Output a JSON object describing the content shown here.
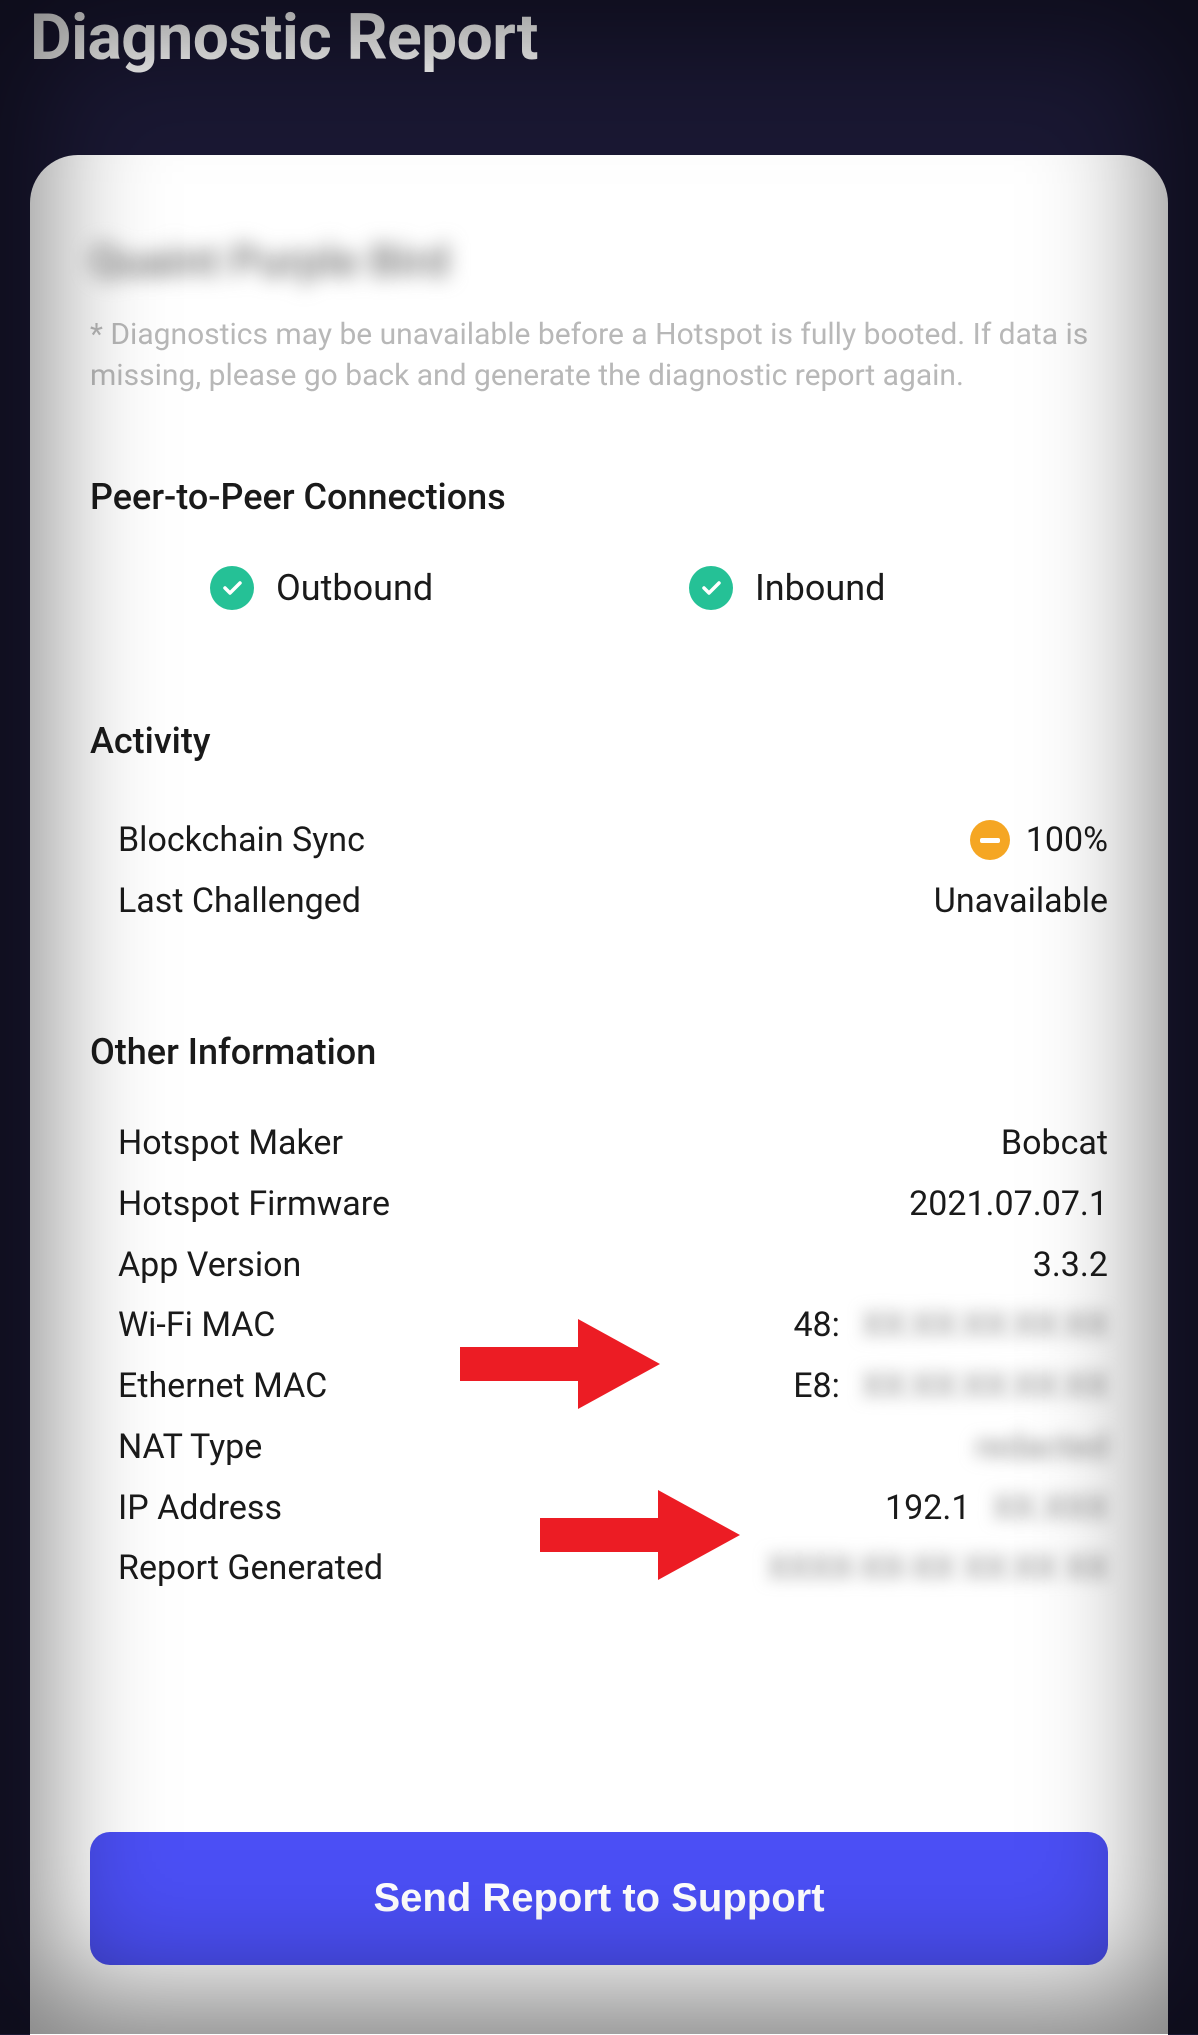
{
  "header": {
    "title": "Diagnostic Report"
  },
  "hotspot_name": "Quaint Purple Bird",
  "disclaimer": "* Diagnostics may be unavailable before a Hotspot is fully booted. If data is missing, please go back and generate the diagnostic report again.",
  "p2p": {
    "title": "Peer-to-Peer Connections",
    "outbound_label": "Outbound",
    "outbound_ok": true,
    "inbound_label": "Inbound",
    "inbound_ok": true
  },
  "activity": {
    "title": "Activity",
    "blockchain_sync_label": "Blockchain Sync",
    "blockchain_sync_value": "100%",
    "blockchain_sync_status": "warning",
    "last_challenged_label": "Last Challenged",
    "last_challenged_value": "Unavailable"
  },
  "other": {
    "title": "Other Information",
    "rows": {
      "hotspot_maker": {
        "label": "Hotspot Maker",
        "value": "Bobcat"
      },
      "hotspot_firmware": {
        "label": "Hotspot Firmware",
        "value": "2021.07.07.1"
      },
      "app_version": {
        "label": "App Version",
        "value": "3.3.2"
      },
      "wifi_mac": {
        "label": "Wi-Fi MAC",
        "prefix": "48:",
        "redacted": "XX:XX:XX:XX:XX"
      },
      "ethernet_mac": {
        "label": "Ethernet MAC",
        "prefix": "E8:",
        "redacted": "XX:XX:XX:XX:XX"
      },
      "nat_type": {
        "label": "NAT Type",
        "redacted": "redacted"
      },
      "ip_address": {
        "label": "IP Address",
        "prefix": "192.1",
        "redacted": "XX.XXX"
      },
      "report_generated": {
        "label": "Report Generated",
        "redacted": "XXXX-XX-XX XX:XX XX"
      }
    }
  },
  "send_button_label": "Send Report to Support",
  "colors": {
    "accent": "#4b4ff5",
    "success": "#25c196",
    "warning": "#f5a623",
    "annotation": "#ec1c24"
  }
}
